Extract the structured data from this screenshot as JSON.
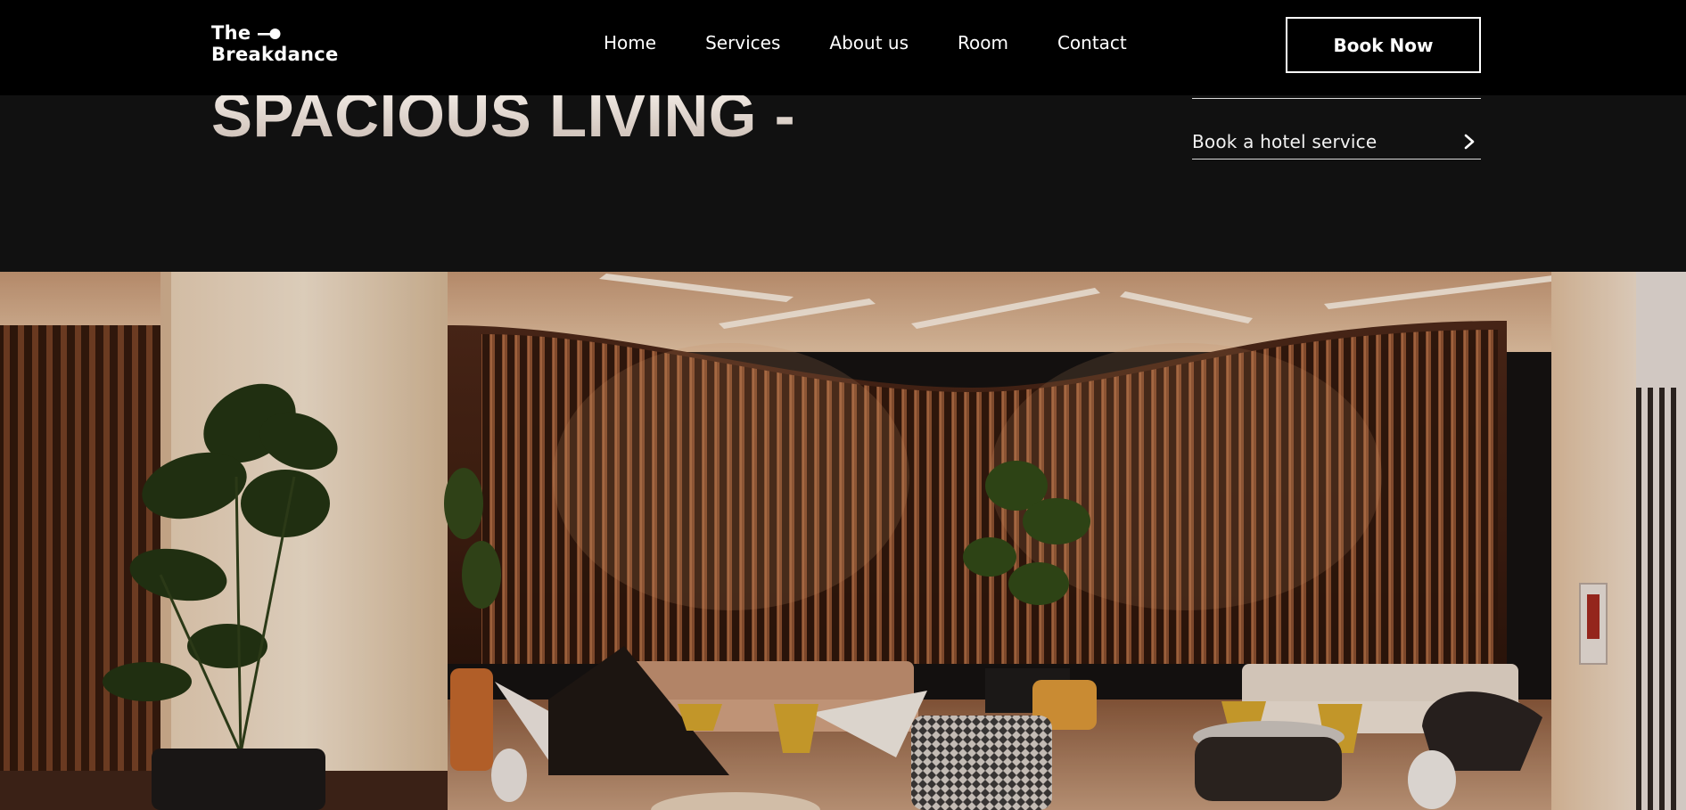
{
  "nav": {
    "logo": {
      "line1": "The",
      "line2": "Breakdance"
    },
    "links": [
      {
        "label": "Home"
      },
      {
        "label": "Services"
      },
      {
        "label": "About us"
      },
      {
        "label": "Room"
      },
      {
        "label": "Contact"
      }
    ],
    "cta_label": "Book Now"
  },
  "hero": {
    "title": "SPACIOUS LIVING -",
    "services": [
      {
        "label": "Book a hotel service"
      }
    ]
  },
  "colors": {
    "navbar_bg": "#000000",
    "hero_bg": "#111111",
    "text": "#ffffff"
  },
  "icons": {
    "logo_mark": "toggle-dot-icon",
    "service_arrow": "chevron-right-icon"
  }
}
